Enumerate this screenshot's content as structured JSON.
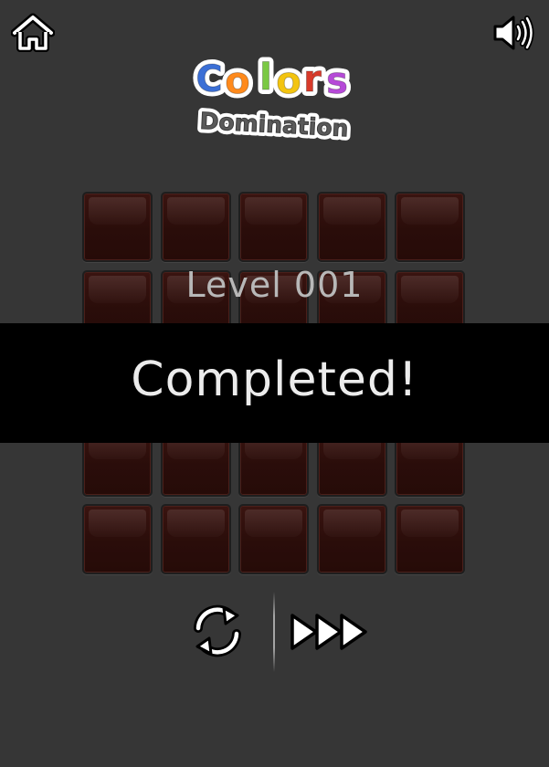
{
  "header": {
    "home_icon": "home-icon",
    "sound_icon": "speaker-volume-icon"
  },
  "logo": {
    "word1": "Colors",
    "word2": "Domination",
    "letter_colors": [
      "#3b6fd6",
      "#ff8a1c",
      "#7ac943",
      "#f3c410",
      "#d83a2a",
      "#b64ad8"
    ]
  },
  "board": {
    "rows": 5,
    "cols": 5,
    "tile_color": "#2d0e0b"
  },
  "level": {
    "label": "Level 001"
  },
  "banner": {
    "text": "Completed!"
  },
  "controls": {
    "replay_icon": "replay-icon",
    "next_icon": "fast-forward-icon"
  }
}
